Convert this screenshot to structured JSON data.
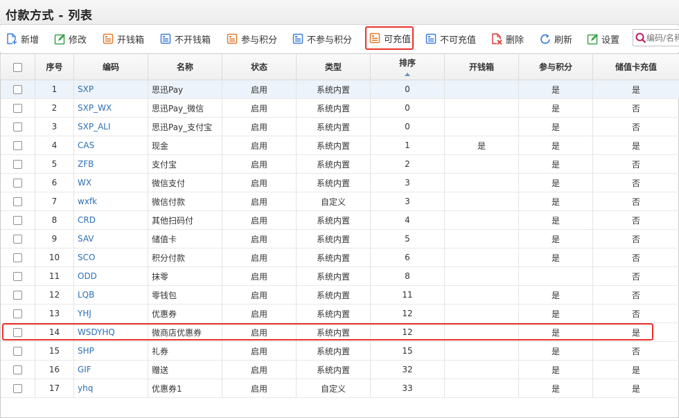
{
  "window": {
    "title": "付款方式 - 列表"
  },
  "toolbar": {
    "buttons": [
      {
        "label": "新增",
        "icon": "add-document-icon"
      },
      {
        "label": "修改",
        "icon": "edit-icon"
      },
      {
        "label": "开钱箱",
        "icon": "cashbox-icon"
      },
      {
        "label": "不开钱箱",
        "icon": "cashbox-off-icon"
      },
      {
        "label": "参与积分",
        "icon": "points-icon"
      },
      {
        "label": "不参与积分",
        "icon": "points-off-icon"
      },
      {
        "label": "可充值",
        "icon": "rechargeable-icon"
      },
      {
        "label": "不可充值",
        "icon": "non-rechargeable-icon"
      },
      {
        "label": "删除",
        "icon": "delete-icon"
      },
      {
        "label": "刷新",
        "icon": "refresh-icon"
      },
      {
        "label": "设置",
        "icon": "settings-icon"
      }
    ],
    "highlighted_button": "可充值"
  },
  "search": {
    "placeholder": "编码/名称"
  },
  "table": {
    "columns": [
      "序号",
      "编码",
      "名称",
      "状态",
      "类型",
      "排序",
      "开钱箱",
      "参与积分",
      "储值卡充值"
    ],
    "sorted_column": "排序",
    "sort_direction": "ascending",
    "rows": [
      {
        "no": "1",
        "code": "SXP",
        "name": "思迅Pay",
        "status": "启用",
        "type": "系统内置",
        "sort": "0",
        "cashbox": "",
        "points": "是",
        "recharge": "是"
      },
      {
        "no": "2",
        "code": "SXP_WX",
        "name": "思迅Pay_微信",
        "status": "启用",
        "type": "系统内置",
        "sort": "0",
        "cashbox": "",
        "points": "是",
        "recharge": "否"
      },
      {
        "no": "3",
        "code": "SXP_ALI",
        "name": "思迅Pay_支付宝",
        "status": "启用",
        "type": "系统内置",
        "sort": "0",
        "cashbox": "",
        "points": "是",
        "recharge": "否"
      },
      {
        "no": "4",
        "code": "CAS",
        "name": "现金",
        "status": "启用",
        "type": "系统内置",
        "sort": "1",
        "cashbox": "是",
        "points": "是",
        "recharge": "是"
      },
      {
        "no": "5",
        "code": "ZFB",
        "name": "支付宝",
        "status": "启用",
        "type": "系统内置",
        "sort": "2",
        "cashbox": "",
        "points": "是",
        "recharge": "否"
      },
      {
        "no": "6",
        "code": "WX",
        "name": "微信支付",
        "status": "启用",
        "type": "系统内置",
        "sort": "3",
        "cashbox": "",
        "points": "是",
        "recharge": "否"
      },
      {
        "no": "7",
        "code": "wxfk",
        "name": "微信付款",
        "status": "启用",
        "type": "自定义",
        "sort": "3",
        "cashbox": "",
        "points": "是",
        "recharge": "否"
      },
      {
        "no": "8",
        "code": "CRD",
        "name": "其他扫码付",
        "status": "启用",
        "type": "系统内置",
        "sort": "4",
        "cashbox": "",
        "points": "是",
        "recharge": "否"
      },
      {
        "no": "9",
        "code": "SAV",
        "name": "储值卡",
        "status": "启用",
        "type": "系统内置",
        "sort": "5",
        "cashbox": "",
        "points": "是",
        "recharge": "否"
      },
      {
        "no": "10",
        "code": "SCO",
        "name": "积分付款",
        "status": "启用",
        "type": "系统内置",
        "sort": "6",
        "cashbox": "",
        "points": "是",
        "recharge": "否"
      },
      {
        "no": "11",
        "code": "ODD",
        "name": "抹零",
        "status": "启用",
        "type": "系统内置",
        "sort": "8",
        "cashbox": "",
        "points": "",
        "recharge": "否"
      },
      {
        "no": "12",
        "code": "LQB",
        "name": "零钱包",
        "status": "启用",
        "type": "系统内置",
        "sort": "11",
        "cashbox": "",
        "points": "是",
        "recharge": "否"
      },
      {
        "no": "13",
        "code": "YHJ",
        "name": "优惠券",
        "status": "启用",
        "type": "系统内置",
        "sort": "12",
        "cashbox": "",
        "points": "是",
        "recharge": "否"
      },
      {
        "no": "14",
        "code": "WSDYHQ",
        "name": "微商店优惠券",
        "status": "启用",
        "type": "系统内置",
        "sort": "12",
        "cashbox": "",
        "points": "是",
        "recharge": "是"
      },
      {
        "no": "15",
        "code": "SHP",
        "name": "礼券",
        "status": "启用",
        "type": "系统内置",
        "sort": "15",
        "cashbox": "",
        "points": "是",
        "recharge": "否"
      },
      {
        "no": "16",
        "code": "GIF",
        "name": "赠送",
        "status": "启用",
        "type": "系统内置",
        "sort": "32",
        "cashbox": "",
        "points": "是",
        "recharge": "是"
      },
      {
        "no": "17",
        "code": "yhq",
        "name": "优惠券1",
        "status": "启用",
        "type": "自定义",
        "sort": "33",
        "cashbox": "",
        "points": "是",
        "recharge": "是"
      }
    ],
    "highlighted_row": "14"
  },
  "colors": {
    "highlight": "#e8312a",
    "link": "#2d6fb3",
    "icon_blue": "#3b7dd8",
    "icon_orange": "#e07a2e",
    "icon_green": "#3aa34a",
    "icon_red": "#d9342b"
  }
}
